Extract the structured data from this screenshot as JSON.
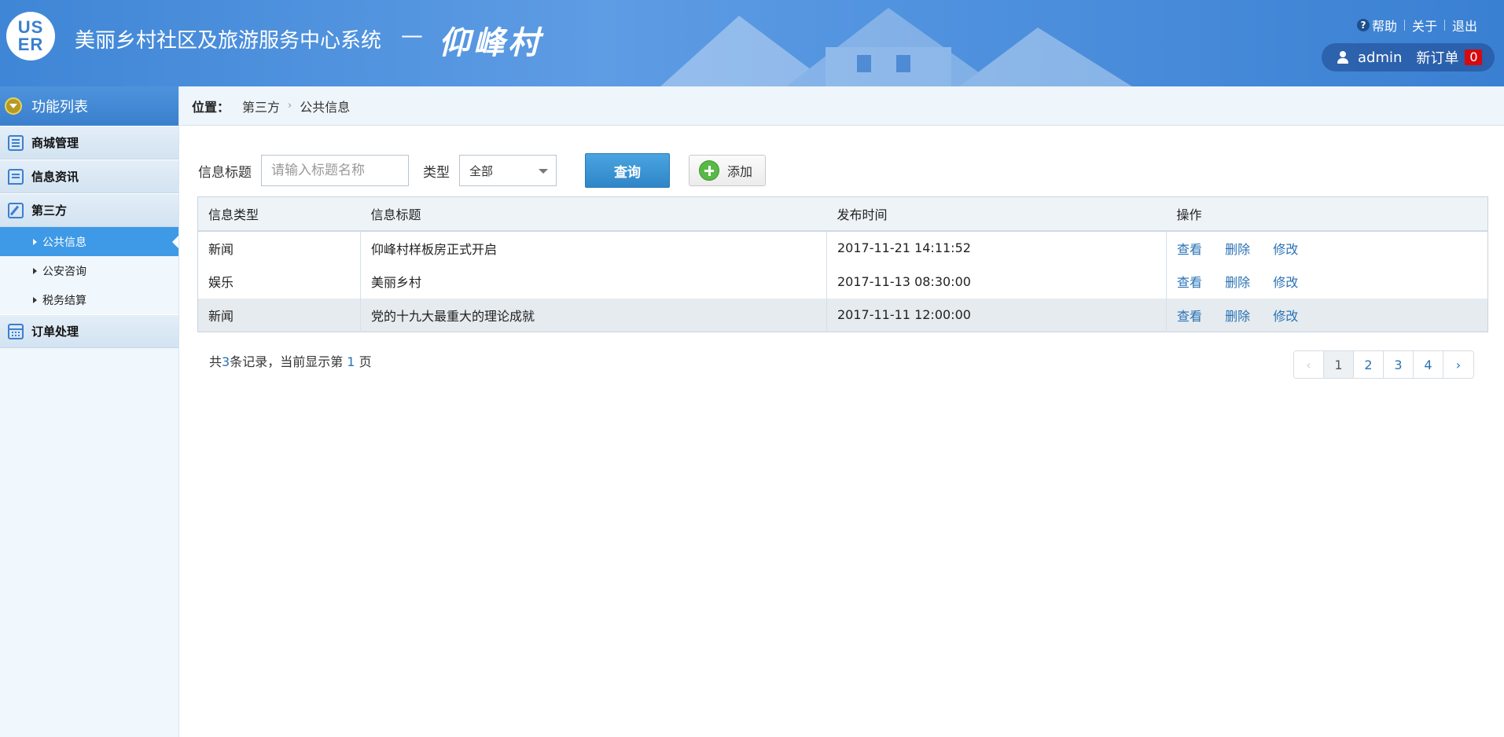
{
  "header": {
    "logo_text": "US\nER",
    "title": "美丽乡村社区及旅游服务中心系统",
    "dash": "—",
    "village": "仰峰村",
    "links": {
      "help": "帮助",
      "about": "关于",
      "logout": "退出"
    },
    "user": "admin",
    "new_order_label": "新订单",
    "new_order_count": "0"
  },
  "sidebar": {
    "head": "功能列表",
    "groups": [
      {
        "label": "商城管理",
        "icon": "list-icon"
      },
      {
        "label": "信息资讯",
        "icon": "chat-icon"
      },
      {
        "label": "第三方",
        "icon": "edit-icon"
      },
      {
        "label": "订单处理",
        "icon": "calendar-icon"
      }
    ],
    "sub_items": [
      "公共信息",
      "公安咨询",
      "税务结算"
    ]
  },
  "breadcrumb": {
    "label": "位置：",
    "path": [
      "第三方",
      "公共信息"
    ]
  },
  "filters": {
    "title_label": "信息标题",
    "title_placeholder": "请输入标题名称",
    "type_label": "类型",
    "type_value": "全部",
    "query_button": "查询",
    "add_button": "添加"
  },
  "table": {
    "headers": [
      "信息类型",
      "信息标题",
      "发布时间",
      "操作"
    ],
    "rows": [
      {
        "type": "新闻",
        "title": "仰峰村样板房正式开启",
        "time": "2017-11-21 14:11:52"
      },
      {
        "type": "娱乐",
        "title": "美丽乡村",
        "time": "2017-11-13 08:30:00"
      },
      {
        "type": "新闻",
        "title": "党的十九大最重大的理论成就",
        "time": "2017-11-11 12:00:00"
      }
    ],
    "actions": {
      "view": "查看",
      "delete": "删除",
      "edit": "修改"
    }
  },
  "summary": {
    "prefix": "共",
    "count": "3",
    "mid": "条记录，当前显示第 ",
    "page": "1",
    "suffix": " 页"
  },
  "pager": {
    "prev": "‹",
    "pages": [
      "1",
      "2",
      "3",
      "4"
    ],
    "next": "›"
  }
}
